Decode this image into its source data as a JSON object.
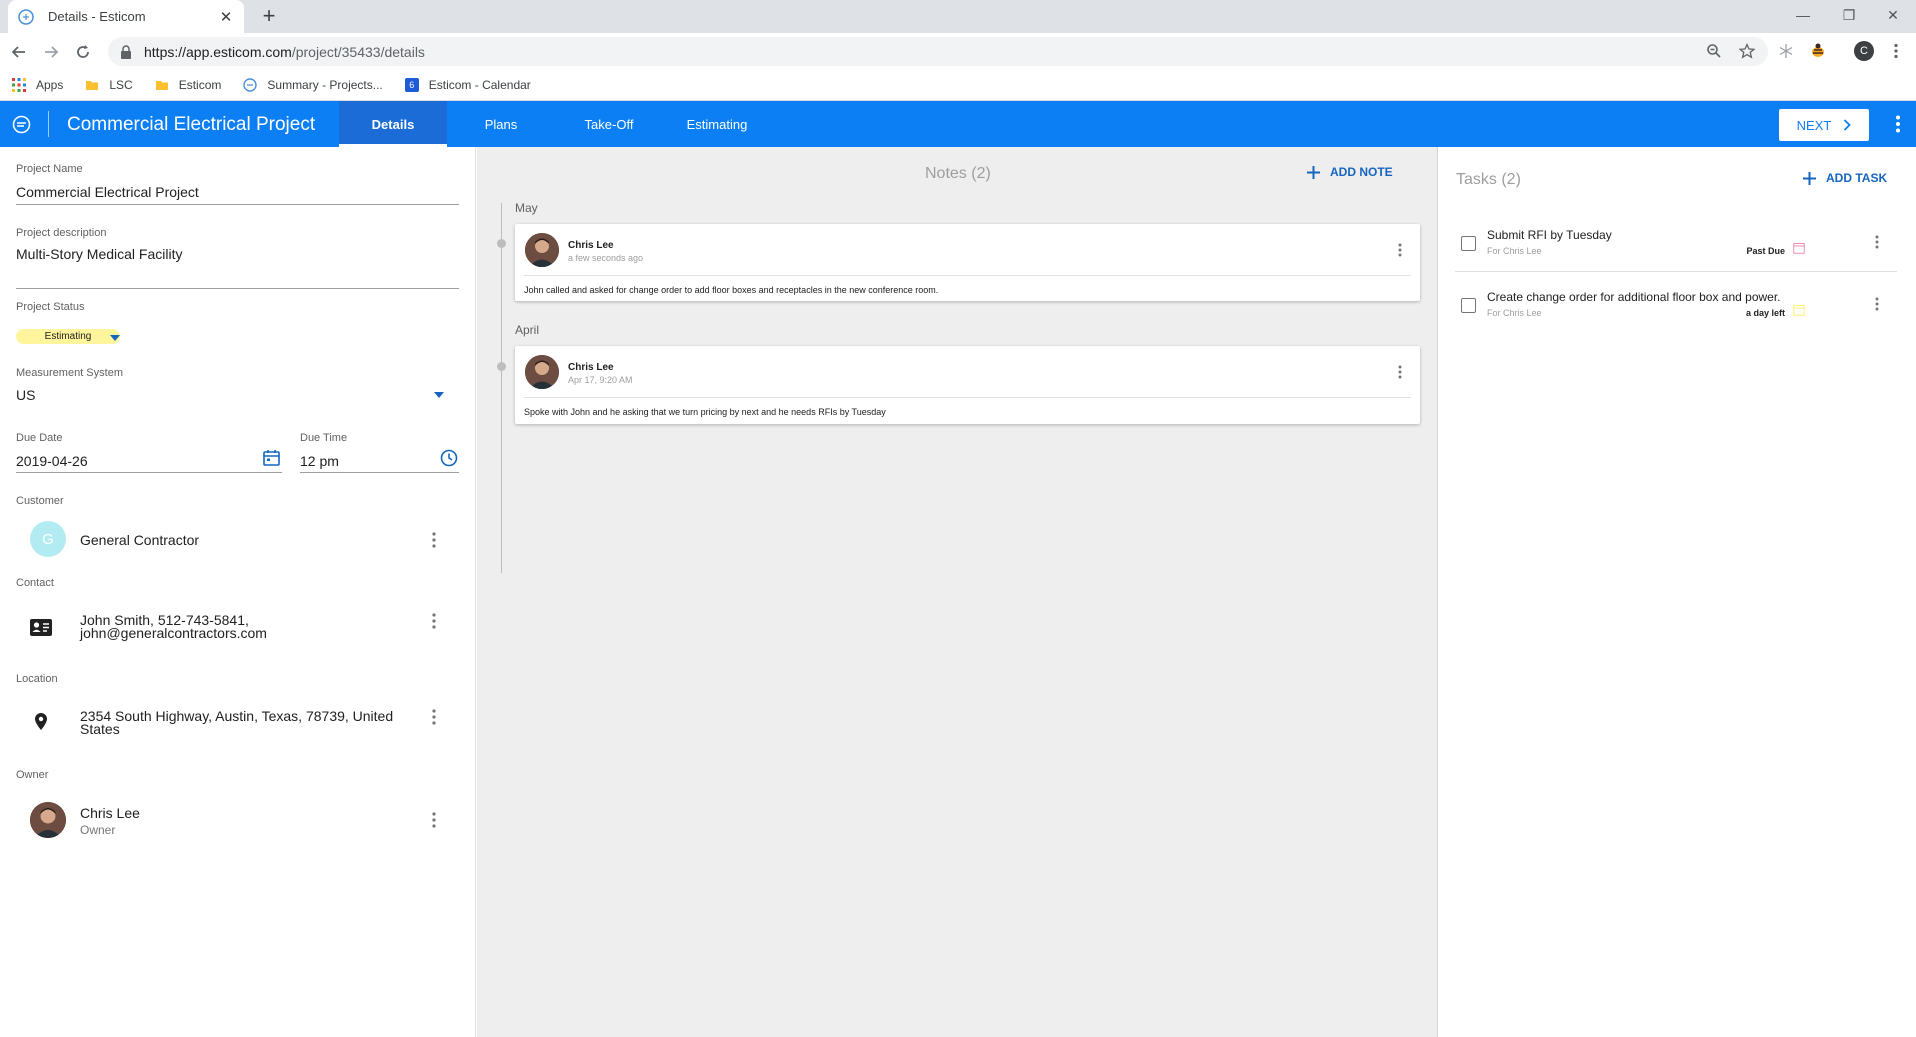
{
  "browser": {
    "tab_title": "Details - Esticom",
    "url_host": "https://app.esticom.com",
    "url_path": "/project/35433/details",
    "profile_letter": "C",
    "bookmarks": [
      {
        "label": "Apps",
        "icon": "apps-grid-icon"
      },
      {
        "label": "LSC",
        "icon": "folder-icon"
      },
      {
        "label": "Esticom",
        "icon": "folder-icon"
      },
      {
        "label": "Summary - Projects...",
        "icon": "esticom-favicon"
      },
      {
        "label": "Esticom - Calendar",
        "icon": "calendar-icon",
        "badge": "6"
      }
    ]
  },
  "header": {
    "project_title": "Commercial Electrical Project",
    "tabs": [
      {
        "label": "Details",
        "active": true
      },
      {
        "label": "Plans",
        "active": false
      },
      {
        "label": "Take-Off",
        "active": false
      },
      {
        "label": "Estimating",
        "active": false
      }
    ],
    "next_label": "NEXT",
    "accent": "#0d7ff5"
  },
  "details": {
    "project_name_label": "Project Name",
    "project_name": "Commercial Electrical Project",
    "description_label": "Project description",
    "description": "Multi-Story Medical Facility",
    "status_label": "Project Status",
    "status": "Estimating",
    "status_color": "#fff59d",
    "measurement_label": "Measurement System",
    "measurement": "US",
    "due_date_label": "Due Date",
    "due_date": "2019-04-26",
    "due_time_label": "Due Time",
    "due_time": "12 pm",
    "customer_label": "Customer",
    "customer_initial": "G",
    "customer": "General Contractor",
    "contact_label": "Contact",
    "contact_line1": "John Smith, 512-743-5841,",
    "contact_line2": "john@generalcontractors.com",
    "location_label": "Location",
    "location_line1": "2354 South Highway, Austin, Texas, 78739, United",
    "location_line2": "States",
    "owner_label": "Owner",
    "owner_name": "Chris Lee",
    "owner_role": "Owner"
  },
  "notes": {
    "title": "Notes (2)",
    "add_label": "ADD NOTE",
    "groups": [
      {
        "month": "May",
        "author": "Chris Lee",
        "time": "a few seconds ago",
        "text": "John called and asked for change order to add floor boxes and receptacles in the new conference room."
      },
      {
        "month": "April",
        "author": "Chris Lee",
        "time": "Apr 17, 9:20 AM",
        "text": "Spoke with John and he asking that we turn pricing by next and he needs RFIs by Tuesday"
      }
    ]
  },
  "tasks": {
    "title": "Tasks (2)",
    "add_label": "ADD TASK",
    "items": [
      {
        "title": "Submit RFI by Tuesday",
        "for": "For Chris Lee",
        "due": "Past Due",
        "cal_color": "#f48fb1"
      },
      {
        "title": "Create change order for additional floor box and power.",
        "for": "For Chris Lee",
        "due": "a day left",
        "cal_color": "#fff176"
      }
    ]
  }
}
